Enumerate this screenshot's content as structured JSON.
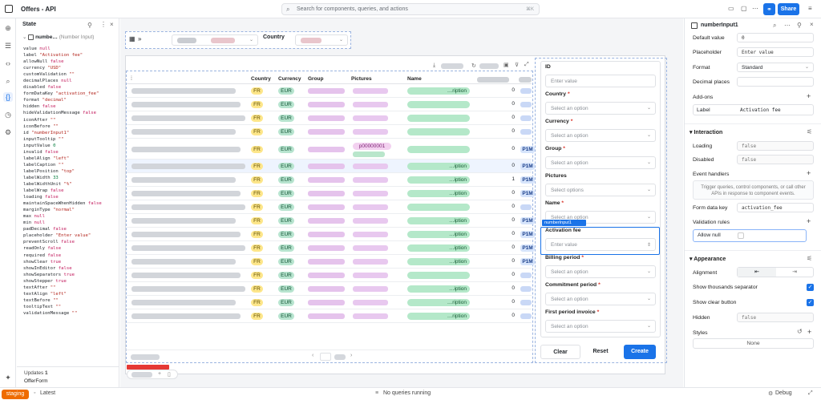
{
  "topbar": {
    "app_title": "Offers - API",
    "search_placeholder": "Search for components, queries, and actions",
    "search_shortcut": "⌘K",
    "share_label": "Share"
  },
  "state_panel": {
    "title": "State",
    "selected_name": "numbe…",
    "selected_type": "(Number Input)",
    "props": [
      [
        "value",
        "null",
        "null"
      ],
      [
        "label",
        "\"Activation fee\"",
        "s"
      ],
      [
        "allowNull",
        "false",
        "b"
      ],
      [
        "currency",
        "\"USD\"",
        "s"
      ],
      [
        "customValidation",
        "\"\"",
        "s"
      ],
      [
        "decimalPlaces",
        "null",
        "null"
      ],
      [
        "disabled",
        "false",
        "b"
      ],
      [
        "formDataKey",
        "\"activation_fee\"",
        "s"
      ],
      [
        "format",
        "\"decimal\"",
        "s"
      ],
      [
        "hidden",
        "false",
        "b"
      ],
      [
        "hideValidationMessage",
        "false",
        "b"
      ],
      [
        "iconAfter",
        "\"\"",
        "s"
      ],
      [
        "iconBefore",
        "\"\"",
        "s"
      ],
      [
        "id",
        "\"numberInput1\"",
        "s"
      ],
      [
        "inputTooltip",
        "\"\"",
        "s"
      ],
      [
        "inputValue",
        "0",
        "n"
      ],
      [
        "invalid",
        "false",
        "b"
      ],
      [
        "labelAlign",
        "\"left\"",
        "s"
      ],
      [
        "labelCaption",
        "\"\"",
        "s"
      ],
      [
        "labelPosition",
        "\"top\"",
        "s"
      ],
      [
        "labelWidth",
        "33",
        "n"
      ],
      [
        "labelWidthUnit",
        "\"%\"",
        "s"
      ],
      [
        "labelWrap",
        "false",
        "b"
      ],
      [
        "loading",
        "false",
        "b"
      ],
      [
        "maintainSpaceWhenHidden",
        "false",
        "b"
      ],
      [
        "marginType",
        "\"normal\"",
        "s"
      ],
      [
        "max",
        "null",
        "null"
      ],
      [
        "min",
        "null",
        "null"
      ],
      [
        "padDecimal",
        "false",
        "b"
      ],
      [
        "placeholder",
        "\"Enter value\"",
        "s"
      ],
      [
        "preventScroll",
        "false",
        "b"
      ],
      [
        "readOnly",
        "false",
        "b"
      ],
      [
        "required",
        "false",
        "b"
      ],
      [
        "showClear",
        "true",
        "b"
      ],
      [
        "showInEditor",
        "false",
        "b"
      ],
      [
        "showSeparators",
        "true",
        "b"
      ],
      [
        "showStepper",
        "true",
        "b"
      ],
      [
        "textAfter",
        "\"\"",
        "s"
      ],
      [
        "textAlign",
        "\"left\"",
        "s"
      ],
      [
        "textBefore",
        "\"\"",
        "s"
      ],
      [
        "tooltipText",
        "\"\"",
        "s"
      ],
      [
        "validationMessage",
        "\"\"",
        "s"
      ]
    ],
    "footer_updates": "Updates",
    "footer_updates_count": "1",
    "footer_name": "OfferForm"
  },
  "filters": {
    "country_label": "Country"
  },
  "table": {
    "columns": [
      "Country",
      "Currency",
      "Group",
      "Pictures",
      "Name"
    ],
    "rows": [
      {
        "country": "FR",
        "currency": "EUR",
        "name": "…ription",
        "num": "0"
      },
      {
        "country": "FR",
        "currency": "EUR",
        "name": "",
        "num": "0"
      },
      {
        "country": "FR",
        "currency": "EUR",
        "name": "",
        "num": "0"
      },
      {
        "country": "FR",
        "currency": "EUR",
        "name": "",
        "num": "0"
      },
      {
        "country": "FR",
        "currency": "EUR",
        "picture": "p00000001",
        "name": "",
        "num": "0",
        "tag": "P1M"
      },
      {
        "country": "FR",
        "currency": "EUR",
        "name": "…iption",
        "num": "0",
        "tag": "P1M"
      },
      {
        "country": "FR",
        "currency": "EUR",
        "name": "…iption",
        "num": "1",
        "tag": "P1M"
      },
      {
        "country": "FR",
        "currency": "EUR",
        "name": "…iption",
        "num": "0",
        "tag": "P1M"
      },
      {
        "country": "FR",
        "currency": "EUR",
        "name": "",
        "num": "0"
      },
      {
        "country": "FR",
        "currency": "EUR",
        "name": "…iption",
        "num": "0",
        "tag": "P1M"
      },
      {
        "country": "FR",
        "currency": "EUR",
        "name": "…iption",
        "num": "0",
        "tag": "P1M"
      },
      {
        "country": "FR",
        "currency": "EUR",
        "name": "…iption",
        "num": "0",
        "tag": "P1M"
      },
      {
        "country": "FR",
        "currency": "EUR",
        "name": "…iption",
        "num": "0",
        "tag": "P1M"
      },
      {
        "country": "FR",
        "currency": "EUR",
        "name": "",
        "num": "0"
      },
      {
        "country": "FR",
        "currency": "EUR",
        "name": "…iption",
        "num": "0"
      },
      {
        "country": "FR",
        "currency": "EUR",
        "name": "…ription",
        "num": "0"
      },
      {
        "country": "FR",
        "currency": "EUR",
        "name": "…ription",
        "num": "0"
      }
    ]
  },
  "form": {
    "fields": [
      {
        "label": "ID",
        "req": "",
        "placeholder": "Enter value",
        "select": false
      },
      {
        "label": "Country",
        "req": "*",
        "placeholder": "Select an option",
        "select": true
      },
      {
        "label": "Currency",
        "req": "*",
        "placeholder": "Select an option",
        "select": true
      },
      {
        "label": "Group",
        "req": "*",
        "placeholder": "Select an option",
        "select": true
      },
      {
        "label": "Pictures",
        "req": "",
        "placeholder": "Select options",
        "select": true
      },
      {
        "label": "Name",
        "req": "*",
        "placeholder": "Select an option",
        "select": true
      },
      {
        "label": "Activation fee",
        "req": "",
        "placeholder": "Enter value",
        "select": false
      },
      {
        "label": "Billing period",
        "req": "*",
        "placeholder": "Select an option",
        "select": true
      },
      {
        "label": "Commitment period",
        "req": "*",
        "placeholder": "Select an option",
        "select": true
      },
      {
        "label": "First period invoice",
        "req": "*",
        "placeholder": "Select an option",
        "select": true
      }
    ],
    "selected_tag": "numberInput1",
    "clear_label": "Clear",
    "reset_label": "Reset",
    "create_label": "Create"
  },
  "inspector": {
    "component_name": "numberInput1",
    "default_value_label": "Default value",
    "default_value": "0",
    "placeholder_label": "Placeholder",
    "placeholder_value": "Enter value",
    "format_label": "Format",
    "format_value": "Standard",
    "decimal_places_label": "Decimal places",
    "addons_label": "Add-ons",
    "label_label": "Label",
    "label_value": "Activation fee",
    "interaction_label": "Interaction",
    "loading_label": "Loading",
    "loading_value": "false",
    "disabled_label": "Disabled",
    "disabled_value": "false",
    "event_handlers_label": "Event handlers",
    "event_handlers_hint": "Trigger queries, control components, or call other APIs in response to component events.",
    "form_data_key_label": "Form data key",
    "form_data_key_value": "activation_fee",
    "validation_rules_label": "Validation rules",
    "allow_null_label": "Allow null",
    "appearance_label": "Appearance",
    "alignment_label": "Alignment",
    "thousands_label": "Show thousands separator",
    "clear_button_label": "Show clear button",
    "hidden_label": "Hidden",
    "hidden_value": "false",
    "styles_label": "Styles",
    "styles_value": "None"
  },
  "bottombar": {
    "env_label": "staging",
    "version_label": "Latest",
    "queries_status": "No queries running",
    "debug_label": "Debug"
  }
}
